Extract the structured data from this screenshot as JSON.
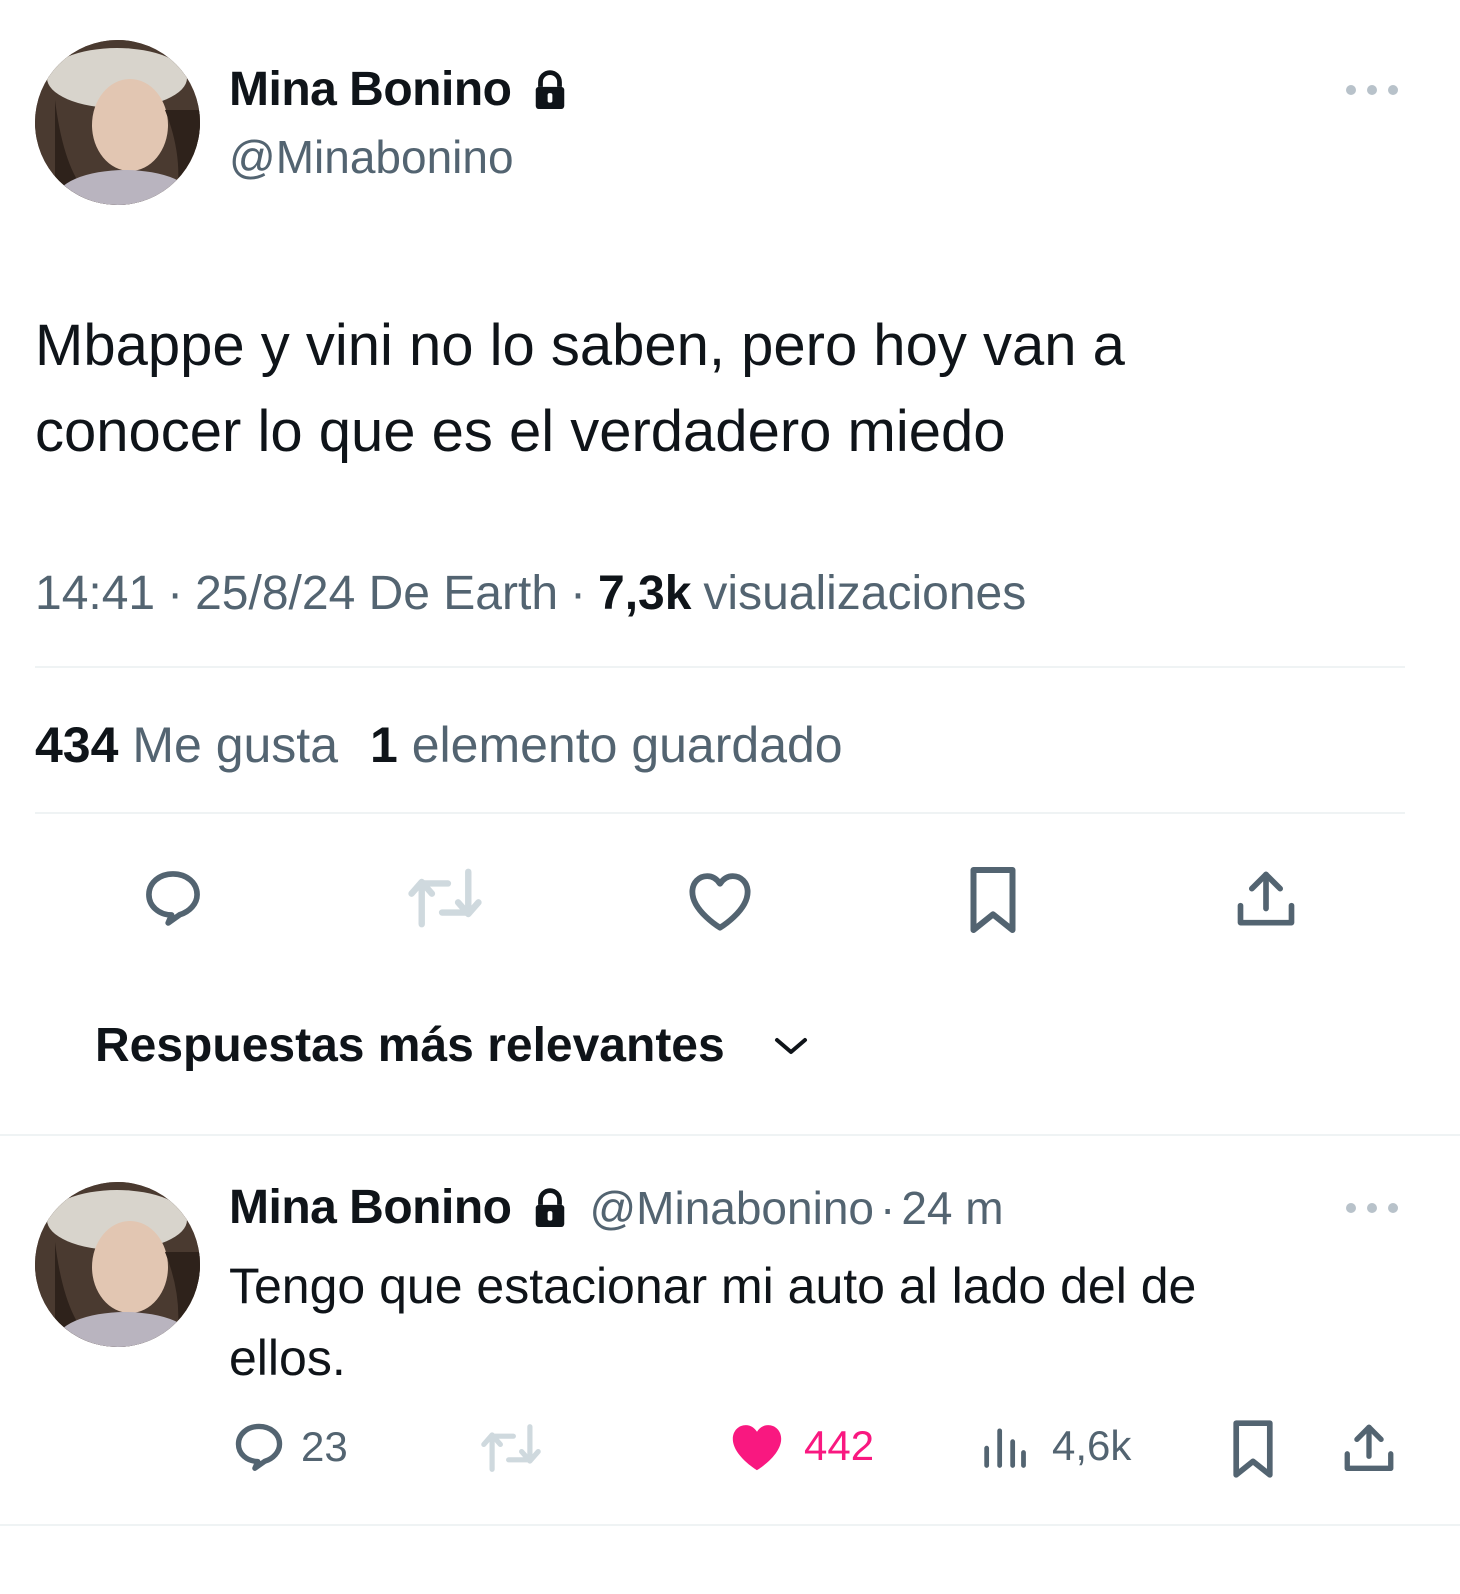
{
  "main_tweet": {
    "author_name": "Mina Bonino",
    "handle": "@Minabonino",
    "text_line1": "Mbappe y vini no lo saben, pero hoy van a",
    "text_line2": "conocer lo que es el verdadero miedo",
    "time": "14:41",
    "sep1": "·",
    "date_source": "25/8/24 De Earth",
    "sep2": "·",
    "views_count": "7,3k",
    "views_label": "visualizaciones",
    "likes_count": "434",
    "likes_label": "Me gusta",
    "saves_count": "1",
    "saves_label": "elemento guardado",
    "icons": [
      "reply-icon",
      "retweet-icon",
      "like-icon",
      "bookmark-icon",
      "share-icon"
    ]
  },
  "replies_sort": {
    "label": "Respuestas más relevantes"
  },
  "reply": {
    "author_name": "Mina Bonino",
    "handle": "@Minabonino",
    "sep": "·",
    "time": "24 m",
    "text_line1": "Tengo que estacionar mi auto al lado del de",
    "text_line2": "ellos.",
    "reply_count": "23",
    "like_count": "442",
    "view_count": "4,6k"
  },
  "colors": {
    "text": "#0f1419",
    "secondary": "#536471",
    "like_pink": "#f91880",
    "divider": "#eff3f4",
    "retweet_disabled": "#cfd9de"
  }
}
